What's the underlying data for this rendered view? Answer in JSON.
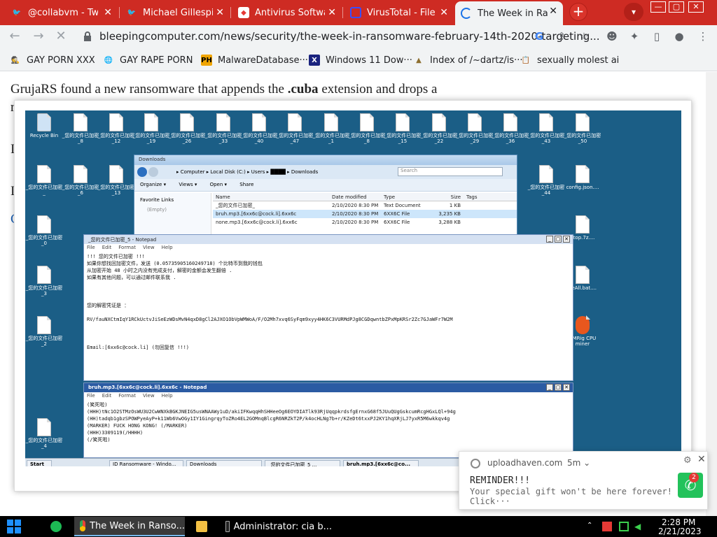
{
  "browser": {
    "tabs": [
      {
        "title": "@collabvm - Twi",
        "icon": "twitter-icon",
        "color": "#1d9bf0"
      },
      {
        "title": "Michael Gillespie",
        "icon": "twitter-icon",
        "color": "#1d9bf0"
      },
      {
        "title": "Antivirus Softwa",
        "icon": "shield-icon",
        "color": "#e53935"
      },
      {
        "title": "VirusTotal - File",
        "icon": "virustotal-icon",
        "color": "#394eff"
      },
      {
        "title": "The Week in Ran",
        "icon": "loading-icon",
        "color": "#1a73e8",
        "active": true
      }
    ],
    "url": "bleepingcomputer.com/news/security/the-week-in-ransomware-february-14th-2020-targeting...",
    "bookmarks": [
      {
        "label": "GAY PORN XXX",
        "icon": "spy-icon"
      },
      {
        "label": "GAY RAPE PORN",
        "icon": "globe-icon"
      },
      {
        "label": "MalwareDatabase···",
        "icon": "ph-icon"
      },
      {
        "label": "Windows 11 Dow···",
        "icon": "x-icon"
      },
      {
        "label": "Index of /~dartz/is···",
        "icon": "folder-icon"
      },
      {
        "label": "sexually molest ai",
        "icon": "clipboard-icon"
      }
    ]
  },
  "article": {
    "text_before": "GrujaRS found a new ransomware that appends the ",
    "extension": ".cuba",
    "text_after": " extension and drops a",
    "side_letters": [
      "r",
      "I",
      "I",
      "C"
    ]
  },
  "screenshot": {
    "desktop_icons": [
      "Recycle Bin",
      "_您的文件已加密_8",
      "_您的文件已加密_12",
      "_您的文件已加密_19",
      "_您的文件已加密_26",
      "_您的文件已加密_33",
      "_您的文件已加密_40",
      "_您的文件已加密_47",
      "_您的文件已加密_1",
      "_您的文件已加密_8",
      "_您的文件已加密_15",
      "_您的文件已加密_22",
      "_您的文件已加密_29",
      "_您的文件已加密_36",
      "_您的文件已加密_43",
      "_您的文件已加密_50"
    ],
    "right_icons": [
      "_您的文件已加密_44",
      "config.json....",
      "ktop.7z....",
      "deAll.bat....",
      "CMRig CPU miner"
    ],
    "left_icons": [
      "_您的文件已加密_",
      "_您的文件已加密_6",
      "_您的文件已加密_13",
      "_您的文件已加密_0",
      "_您的文件已加密_3",
      "_您的文件已加密_2",
      "_您的文件已加密_4"
    ],
    "explorer": {
      "title": "Downloads",
      "breadcrumb": "▸ Computer ▸ Local Disk (C:) ▸ Users ▸ ████ ▸ Downloads",
      "search_placeholder": "Search",
      "commands": [
        "Organize ▾",
        "Views ▾",
        "Open ▾",
        "Share"
      ],
      "left_pane": [
        "Favorite Links",
        "(Empty)"
      ],
      "columns": [
        "Name",
        "Date modified",
        "Type",
        "Size",
        "Tags"
      ],
      "rows": [
        {
          "name": "_您的文件已加密_",
          "date": "2/10/2020 8:30 PM",
          "type": "Text Document",
          "size": "1 KB"
        },
        {
          "name": "bruh.mp3.[6xx6c@cock.li].6xx6c",
          "date": "2/10/2020 8:30 PM",
          "type": "6XX6C File",
          "size": "3,235 KB"
        },
        {
          "name": "none.mp3.[6xx6c@cock.li].6xx6c",
          "date": "2/10/2020 8:30 PM",
          "type": "6XX6C File",
          "size": "3,288 KB"
        }
      ]
    },
    "notepad1": {
      "title": "_您的文件已加密_5 - Notepad",
      "menu": [
        "File",
        "Edit",
        "Format",
        "View",
        "Help"
      ],
      "lines": [
        "!!! 您的文件已加密 !!!",
        "",
        "如果你想找回加密文件，发送 (0.05735905160249718) 个比特币到我的钱包",
        "",
        "从加密开始 48 小时之内没有完成支付，解密的金额会发生翻倍 .",
        "",
        "如果有其他问题，可以通过邮件联系我 .",
        "",
        "",
        "",
        "您的解密凭证是 ：",
        "",
        "RV/fauNXCtmIqY1RCkUctvJiSeEzWDsMvN4qxD8gCl2AJXO1ObVpWMWoA/F/O2Mh7xvq6SyFqm9xyy4HK6C3VURMdPJg8CGDqwntbZPxMpKRSr2Zc7GJaWFr7W2M",
        "",
        "",
        "",
        "Email:[6xx6c@cock.li] (勿回复信 !!!)"
      ]
    },
    "notepad2": {
      "title": "bruh.mp3.[6xx6c@cock.li].6xx6c - Notepad",
      "menu": [
        "File",
        "Edit",
        "Format",
        "View",
        "Help"
      ],
      "lines": [
        "(笑死啦)",
        "(HHH)tNc1O2STMzOsWU3U2CwWNXkBGKJNEIG5usWNAAWy1uD/akiIFKwqqHhSHHeeOg6EOYDIATlk93RjUqqpkrdsfgErnxG68f5JUuQUgGskcumRcgHGxLQl+94g",
        "(HH)tadqb1gbzSPOWPyeAyP+k11Wb6VwOGy1IY1GingrqyToZRo4EL2GOMnqBlcgR6NRZkT2P/k4ocHLNg7b+r/KZeDt6txxPJ2KY1hqXRjLJ7yxR5M6wkkqv4g",
        "(MARKER) FUCK HONG KONG! (/MARKER)",
        "(HHH)3309119(/HHHH)",
        "(/笑死啦)"
      ]
    },
    "vm_tasks": [
      "Start",
      "ID Ransomware - Windo...",
      "Downloads",
      "_您的文件已加密_5 ...",
      "bruh.mp3.[6xx6c@co..."
    ]
  },
  "toast": {
    "source": "uploadhaven.com",
    "time": "5m",
    "title": "REMINDER!!!",
    "body": "Your special gift won't be here forever! Click···",
    "badge": "2"
  },
  "taskbar": {
    "items": [
      {
        "label": "The Week in Ranso...",
        "icon": "chrome-icon",
        "active": true
      },
      {
        "label": "",
        "icon": "folder-icon"
      },
      {
        "label": "Administrator:  cia b...",
        "icon": "cmd-icon"
      }
    ],
    "time": "2:28 PM",
    "date": "2/21/2023"
  }
}
